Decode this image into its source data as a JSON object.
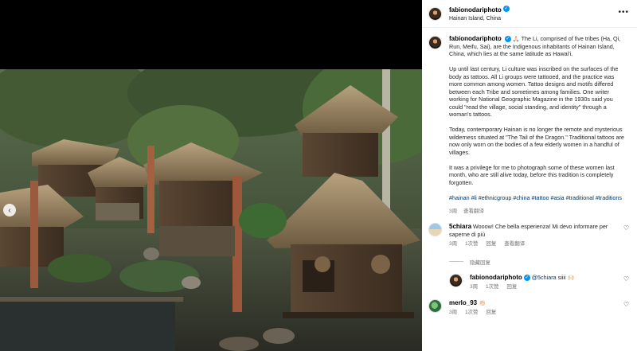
{
  "post": {
    "username": "fabionodariphoto",
    "location": "Hainan Island, China",
    "caption_paragraphs": [
      "🙏🏻 The Li, comprised of five tribes (Ha, Qi, Run, Meifu, Sai), are the Indigenous inhabitants of Hainan Island, China, which lies at the same latitude as Hawai'i.",
      "Up until last century, Li culture was inscribed on the surfaces of the body as tattoos. All Li groups were tattooed, and the practice was more common among women. Tattoo designs and motifs differed between each Tribe and sometimes among families. One writer working for National Geographic Magazine in the 1930s said you could \"read the village, social standing, and identity\" through a woman's tattoos.",
      "Today, contemporary Hainan is no longer the remote and mysterious wilderness situated at \"The Tail of the Dragon.\" Traditional tattoos are now only worn on the bodies of a few elderly women in a handful of villages.",
      "It was a privilege for me to photograph some of these women last month, who are still alive today, before this tradition is completely forgotten."
    ],
    "hashtags": "#hainan #li #ethnicgroup #china #tattoo #asia #traditional #traditions",
    "time": "3周",
    "see_translation": "查看翻译"
  },
  "icons": {
    "more": "more-horizontal-icon",
    "verified": "verified-badge-icon",
    "heart": "heart-outline-icon",
    "prev": "chevron-left-icon"
  },
  "comments": [
    {
      "username": "5chiara",
      "text": "Wooow! Che bella esperienza! Mi devo informare per saperne di più",
      "time": "3周",
      "likes": "1次赞",
      "reply": "回复",
      "see_translation": "查看翻译",
      "hide_replies": "隐藏回复",
      "replies": [
        {
          "username": "fabionodariphoto",
          "mention": "@5chiara",
          "text": "siiii 🙌🏻",
          "time": "3周",
          "likes": "1次赞",
          "reply": "回复"
        }
      ]
    },
    {
      "username": "merlo_93",
      "text": "👏🏻",
      "time": "3周",
      "likes": "1次赞",
      "reply": "回复"
    }
  ],
  "colors": {
    "link": "#00376b",
    "verified": "#0095f6",
    "muted": "#737373"
  }
}
